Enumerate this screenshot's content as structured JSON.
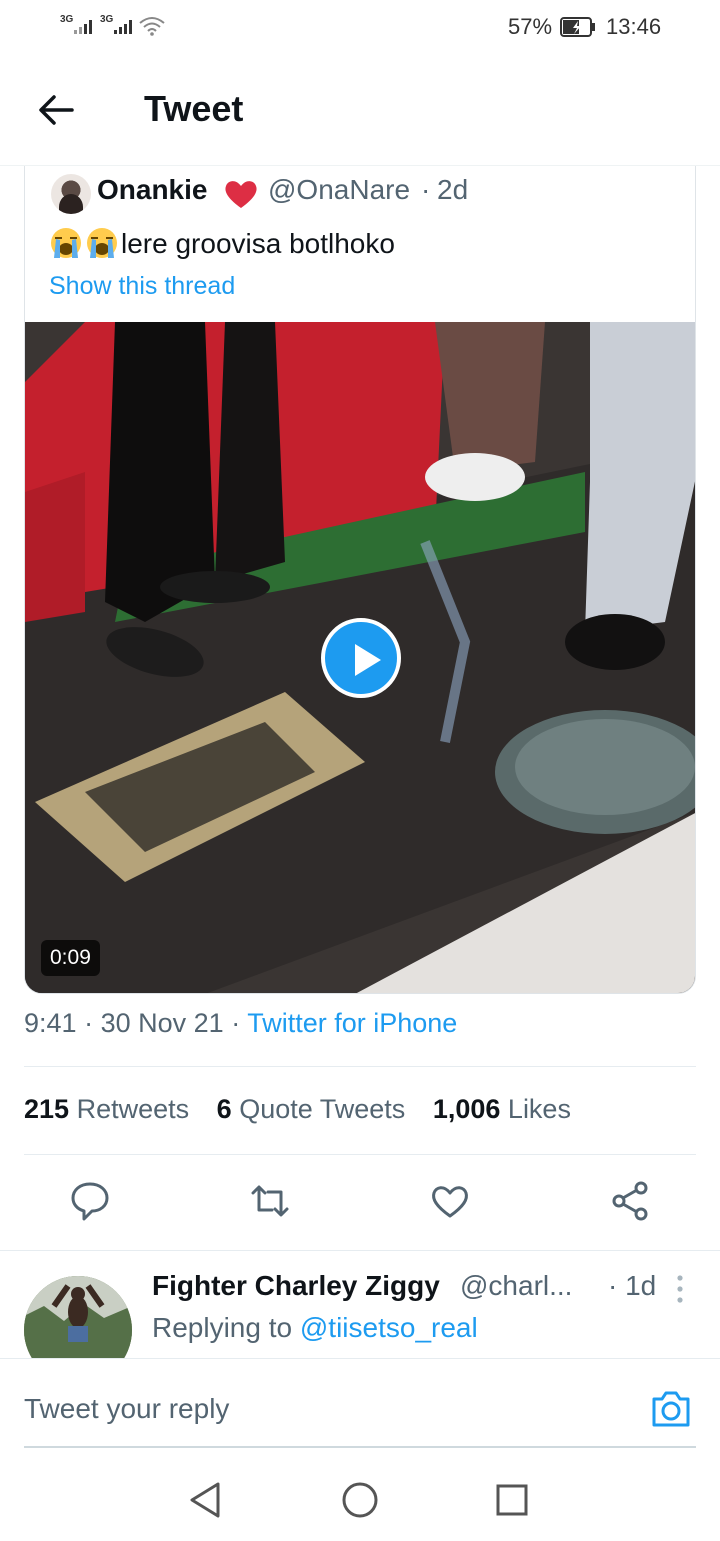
{
  "status_bar": {
    "signal_1": "3G",
    "signal_2": "3G",
    "battery": "57%",
    "time": "13:46"
  },
  "header": {
    "title": "Tweet"
  },
  "quoted_tweet": {
    "name": "Onankie",
    "handle": "@OnaNare",
    "separator": "·",
    "time": "2d",
    "text": "lere groovisa botlhoko",
    "show_thread": "Show this thread",
    "video_duration": "0:09"
  },
  "meta": {
    "time": "9:41",
    "date": "30 Nov 21",
    "separator": "·",
    "source": "Twitter for iPhone"
  },
  "stats": {
    "retweets_count": "215",
    "retweets_label": "Retweets",
    "quotes_count": "6",
    "quotes_label": "Quote Tweets",
    "likes_count": "1,006",
    "likes_label": "Likes"
  },
  "reply": {
    "name": "Fighter Charley Ziggy",
    "handle": "@charl...",
    "time": "· 1d",
    "replying_prefix": "Replying to",
    "mention": "@tiisetso_real"
  },
  "compose": {
    "placeholder": "Tweet your reply"
  },
  "colors": {
    "accent": "#1d9bf0",
    "text_primary": "#0f1419",
    "text_secondary": "#536471"
  },
  "icons": [
    "back-arrow-icon",
    "heart-emoji-icon",
    "crying-face-emoji-icon",
    "play-icon",
    "reply-icon",
    "retweet-icon",
    "like-icon",
    "share-icon",
    "more-icon",
    "camera-icon",
    "nav-back-icon",
    "nav-home-icon",
    "nav-recents-icon"
  ]
}
